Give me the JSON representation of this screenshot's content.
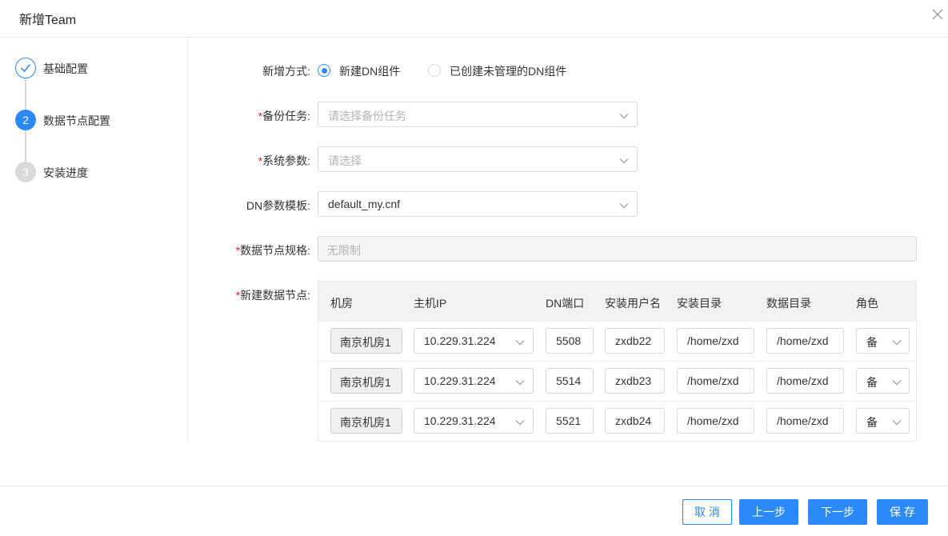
{
  "dialog": {
    "title": "新增Team"
  },
  "steps": [
    {
      "label": "基础配置",
      "state": "done",
      "number": "1"
    },
    {
      "label": "数据节点配置",
      "state": "active",
      "number": "2"
    },
    {
      "label": "安装进度",
      "state": "pending",
      "number": "3"
    }
  ],
  "form": {
    "add_mode": {
      "label": "新增方式:",
      "options": [
        "新建DN组件",
        "已创建未管理的DN组件"
      ],
      "selected": "新建DN组件"
    },
    "backup_task": {
      "required": "*",
      "label": "备份任务:",
      "placeholder": "请选择备份任务"
    },
    "system_params": {
      "required": "*",
      "label": "系统参数:",
      "placeholder": "请选择"
    },
    "dn_template": {
      "label": "DN参数模板:",
      "value": "default_my.cnf"
    },
    "node_spec": {
      "required": "*",
      "label": "数据节点规格:",
      "value": "无限制"
    },
    "new_nodes": {
      "required": "*",
      "label": "新建数据节点:"
    }
  },
  "table": {
    "columns": [
      "机房",
      "主机IP",
      "DN端口",
      "安装用户名",
      "安装目录",
      "数据目录",
      "角色"
    ],
    "rows": [
      {
        "room": "南京机房1",
        "ip": "10.229.31.224",
        "port": "5508",
        "user": "zxdb22",
        "install_dir": "/home/zxd",
        "data_dir": "/home/zxd",
        "role": "备"
      },
      {
        "room": "南京机房1",
        "ip": "10.229.31.224",
        "port": "5514",
        "user": "zxdb23",
        "install_dir": "/home/zxd",
        "data_dir": "/home/zxd",
        "role": "备"
      },
      {
        "room": "南京机房1",
        "ip": "10.229.31.224",
        "port": "5521",
        "user": "zxdb24",
        "install_dir": "/home/zxd",
        "data_dir": "/home/zxd",
        "role": "备"
      }
    ]
  },
  "footer": {
    "cancel": "取 消",
    "prev": "上一步",
    "next": "下一步",
    "save": "保 存"
  },
  "colors": {
    "accent": "#2b8af7",
    "required": "#f5222d"
  },
  "icons": [
    "close-icon",
    "check-icon",
    "chevron-down-icon"
  ]
}
